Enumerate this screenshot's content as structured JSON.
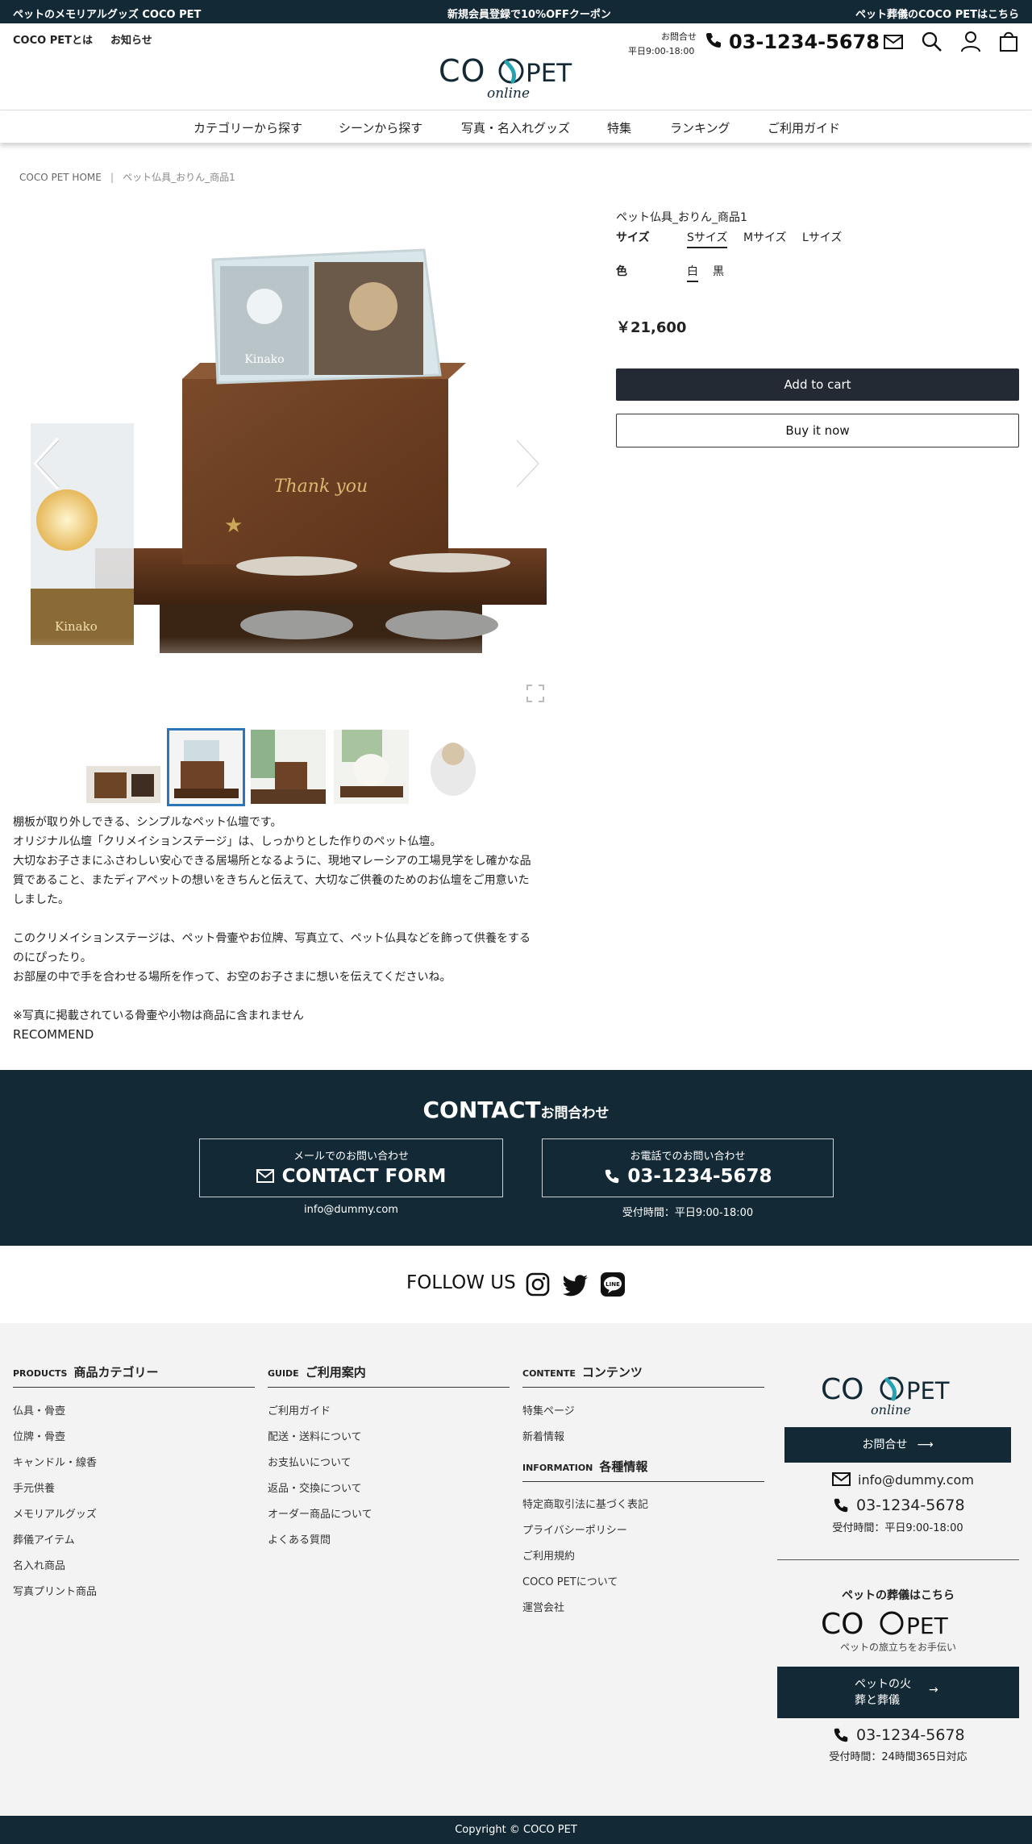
{
  "announce": {
    "left": "ペットのメモリアルグッズ COCO PET",
    "center": "新規会員登録で10%OFFクーポン",
    "right": "ペット葬儀のCOCO PETはこちら"
  },
  "header": {
    "links": [
      "COCO PETとは",
      "お知らせ"
    ],
    "logo_main": "COCOPET",
    "logo_sub": "online",
    "contact_label": "お問合せ",
    "hours": "平日9:00-18:00",
    "phone": "03-1234-5678"
  },
  "nav": [
    "カテゴリーから探す",
    "シーンから探す",
    "写真・名入れグッズ",
    "特集",
    "ランキング",
    "ご利用ガイド"
  ],
  "breadcrumb": {
    "home": "COCO PET HOME",
    "current": "ペット仏具_おりん_商品1"
  },
  "product": {
    "title": "ペット仏具_おりん_商品1",
    "size_label": "サイズ",
    "sizes": [
      "Sサイズ",
      "Mサイズ",
      "Lサイズ"
    ],
    "color_label": "色",
    "colors": [
      "白",
      "黒"
    ],
    "price": "￥21,600",
    "add_to_cart": "Add to cart",
    "buy_now": "Buy it now",
    "photo_name": "Kinako",
    "engraving": "Thank you",
    "description": [
      "棚板が取り外しできる、シンプルなペット仏壇です。",
      "オリジナル仏壇「クリメイションステージ」は、しっかりとした作りのペット仏壇。",
      "大切なお子さまにふさわしい安心できる居場所となるように、現地マレーシアの工場見学をし確かな品",
      "質であること、またディアペットの想いをきちんと伝えて、大切なご供養のためのお仏壇をご用意いた",
      "しました。",
      "",
      "このクリメイションステージは、ペット骨壷やお位牌、写真立て、ペット仏具などを飾って供養をする",
      "のにぴったり。",
      "お部屋の中で手を合わせる場所を作って、お空のお子さまに想いを伝えてくださいね。",
      "",
      "※写真に掲載されている骨壷や小物は商品に含まれません"
    ],
    "recommend": "RECOMMEND"
  },
  "contact": {
    "title_en": "CONTACT",
    "title_jp": "お問合わせ",
    "mail_caption": "メールでのお問い合わせ",
    "mail_label": "CONTACT FORM",
    "mail_address": "info@dummy.com",
    "tel_caption": "お電話でのお問い合わせ",
    "tel_number": "03-1234-5678",
    "tel_hours": "受付時間：平日9:00-18:00"
  },
  "follow": {
    "label": "FOLLOW US",
    "line_badge": "LINE"
  },
  "footer": {
    "products": {
      "en": "PRODUCTS",
      "jp": "商品カテゴリー",
      "items": [
        "仏具・骨壺",
        "位牌・骨壺",
        "キャンドル・線香",
        "手元供養",
        "メモリアルグッズ",
        "葬儀アイテム",
        "名入れ商品",
        "写真プリント商品"
      ]
    },
    "guide": {
      "en": "GUIDE",
      "jp": "ご利用案内",
      "items": [
        "ご利用ガイド",
        "配送・送料について",
        "お支払いについて",
        "返品・交換について",
        "オーダー商品について",
        "よくある質問"
      ]
    },
    "contents": {
      "en": "CONTENTE",
      "jp": "コンテンツ",
      "items": [
        "特集ページ",
        "新着情報"
      ]
    },
    "information": {
      "en": "INFORMATION",
      "jp": "各種情報",
      "items": [
        "特定商取引法に基づく表記",
        "プライバシーポリシー",
        "ご利用規約",
        "COCO PETについて",
        "運営会社"
      ]
    },
    "side": {
      "contact_button": "お問合せ",
      "mail": "info@dummy.com",
      "phone": "03-1234-5678",
      "hours": "受付時間：平日9:00-18:00",
      "funeral_heading": "ペットの葬儀はこちら",
      "funeral_logo": "COCOPET",
      "funeral_tagline": "ペットの旅立ちをお手伝い",
      "funeral_button_line1": "ペットの火",
      "funeral_button_line2": "葬と葬儀",
      "funeral_phone": "03-1234-5678",
      "funeral_hours": "受付時間：24時間365日対応"
    }
  },
  "copyright": "Copyright © COCO PET"
}
